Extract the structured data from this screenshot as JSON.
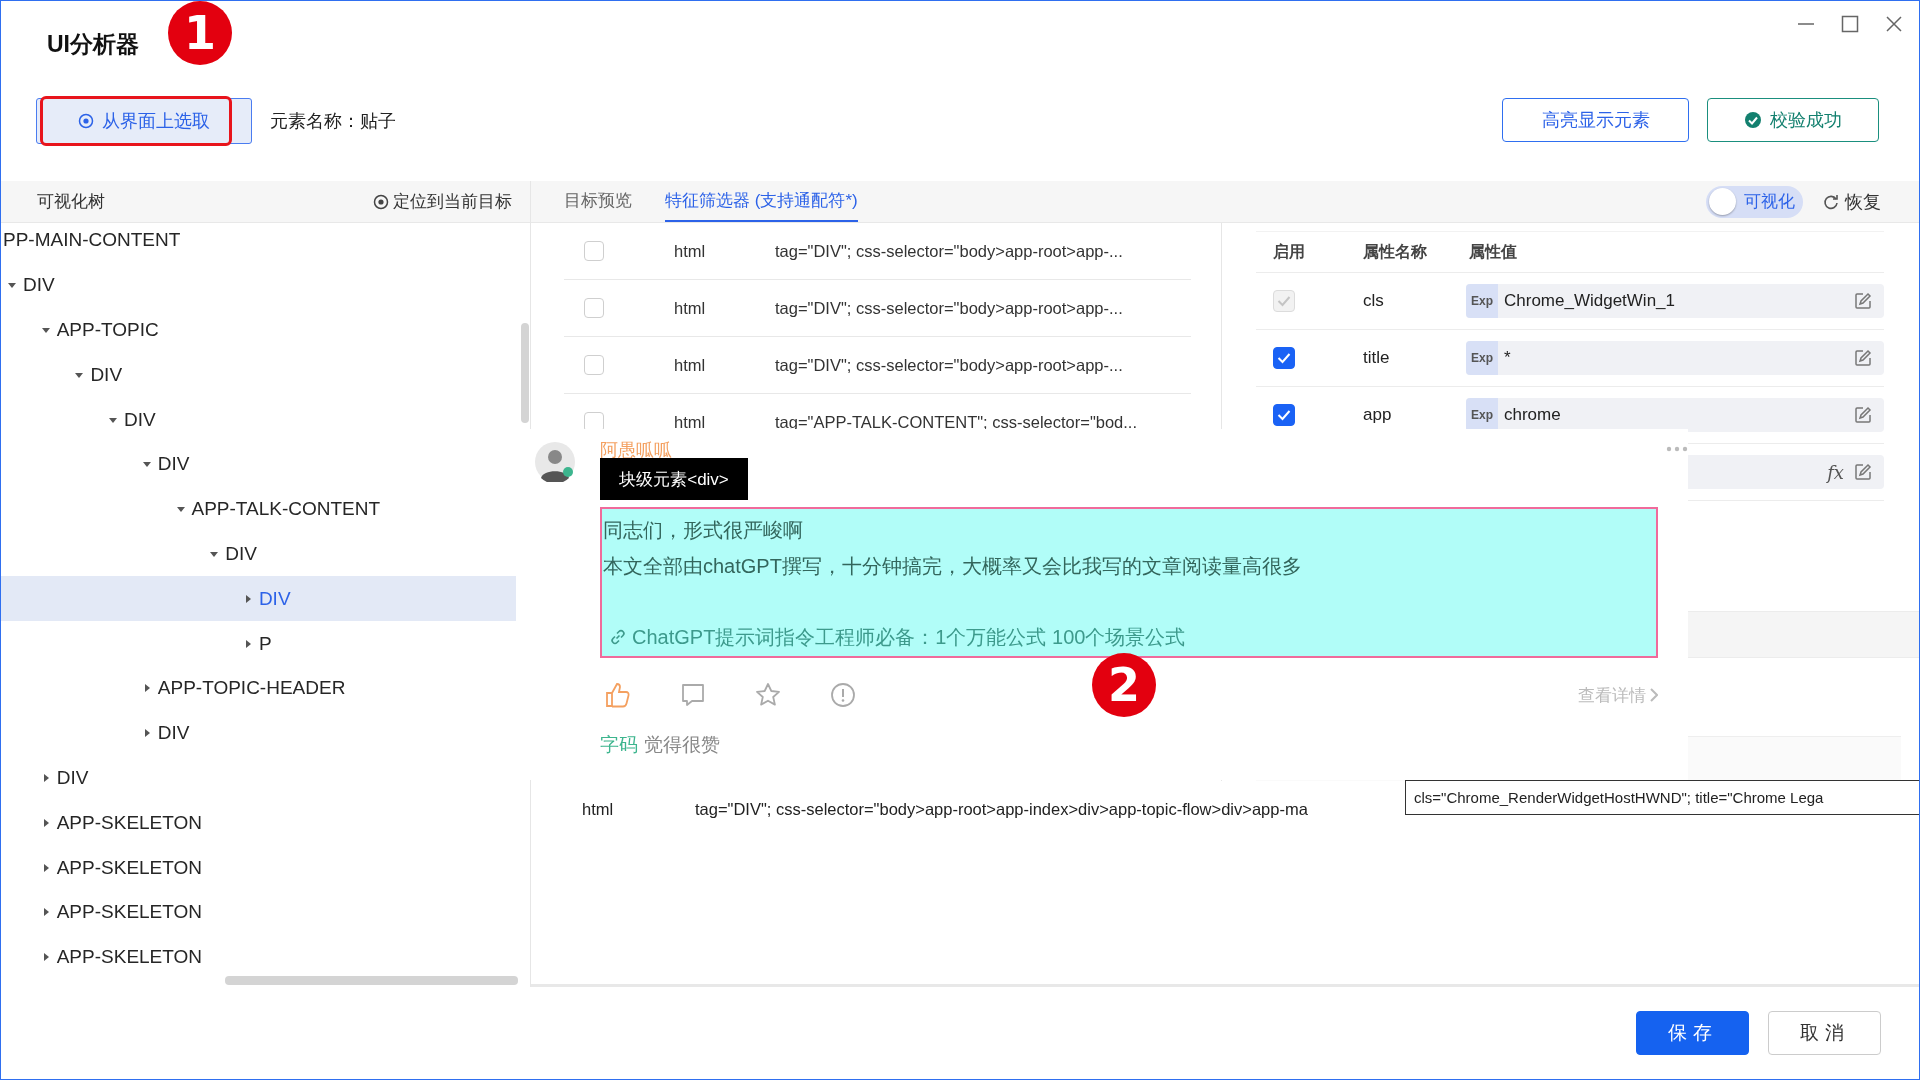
{
  "window": {
    "title": "UI分析器"
  },
  "callouts": [
    {
      "label": "1"
    },
    {
      "label": "2"
    }
  ],
  "toolbar": {
    "pick_button": {
      "label": "从界面上选取",
      "annotated": true
    },
    "element_name": "元素名称：贴子",
    "highlight_button": "高亮显示元素",
    "verify_button": {
      "label": "校验成功",
      "verified": true
    }
  },
  "tree_panel": {
    "title": "可视化树",
    "locate_button": "定位到当前目标",
    "nodes": [
      {
        "label": "PP-MAIN-CONTENT",
        "selected": false,
        "children": [
          {
            "label": "DIV",
            "expanded": true,
            "selected": false,
            "children": [
              {
                "label": "APP-TOPIC",
                "expanded": true,
                "selected": false,
                "children": [
                  {
                    "label": "DIV",
                    "expanded": true,
                    "selected": false,
                    "children": [
                      {
                        "label": "DIV",
                        "expanded": true,
                        "selected": false,
                        "children": [
                          {
                            "label": "DIV",
                            "expanded": true,
                            "selected": false,
                            "children": [
                              {
                                "label": "APP-TALK-CONTENT",
                                "expanded": true,
                                "selected": false,
                                "children": [
                                  {
                                    "label": "DIV",
                                    "expanded": true,
                                    "selected": false,
                                    "children": [
                                      {
                                        "label": "DIV",
                                        "expanded": false,
                                        "selected": true
                                      },
                                      {
                                        "label": "P",
                                        "expanded": false,
                                        "selected": false
                                      }
                                    ]
                                  }
                                ]
                              }
                            ]
                          },
                          {
                            "label": "APP-TOPIC-HEADER",
                            "expanded": false,
                            "selected": false
                          },
                          {
                            "label": "DIV",
                            "expanded": false,
                            "selected": false
                          }
                        ]
                      }
                    ]
                  }
                ]
              },
              {
                "label": "DIV",
                "expanded": false,
                "selected": false
              },
              {
                "label": "APP-SKELETON",
                "expanded": false,
                "selected": false
              },
              {
                "label": "APP-SKELETON",
                "expanded": false,
                "selected": false
              },
              {
                "label": "APP-SKELETON",
                "expanded": false,
                "selected": false
              },
              {
                "label": "APP-SKELETON",
                "expanded": false,
                "selected": false
              }
            ]
          }
        ]
      }
    ]
  },
  "tabs": [
    {
      "label": "目标预览",
      "selected": false
    },
    {
      "label": "特征筛选器 (支持通配符*)",
      "selected": true
    }
  ],
  "visualize_toggle": {
    "label": "可视化",
    "on": false
  },
  "restore_button": "恢复",
  "filter_rows": [
    {
      "checked": false,
      "type": "html",
      "selector": "tag=\"DIV\"; css-selector=\"body>app-root>app-..."
    },
    {
      "checked": false,
      "type": "html",
      "selector": "tag=\"DIV\"; css-selector=\"body>app-root>app-..."
    },
    {
      "checked": false,
      "type": "html",
      "selector": "tag=\"DIV\"; css-selector=\"body>app-root>app-..."
    },
    {
      "checked": false,
      "type": "html",
      "selector": "tag=\"APP-TALK-CONTENT\"; css-selector=\"bod..."
    }
  ],
  "properties": {
    "columns": [
      "启用",
      "属性名称",
      "属性值"
    ],
    "rows": [
      {
        "kind": "exp",
        "enabled": true,
        "disabled": true,
        "name": "cls",
        "badge": "Exp",
        "value": "Chrome_WidgetWin_1"
      },
      {
        "kind": "exp",
        "enabled": true,
        "disabled": false,
        "name": "title",
        "badge": "Exp",
        "value": "*"
      },
      {
        "kind": "exp",
        "enabled": true,
        "disabled": false,
        "name": "app",
        "badge": "Exp",
        "value": "chrome"
      },
      {
        "kind": "fx",
        "icon_text": "fx"
      }
    ]
  },
  "post_popup": {
    "author": "阿愚呱呱",
    "element_tooltip": "块级元素<div>",
    "lines": [
      "同志们，形式很严峻啊",
      "本文全部由chatGPT撰写，十分钟搞完，大概率又会比我写的文章阅读量高很多"
    ],
    "link": "ChatGPT提示词指令工程师必备：1个万能公式 100个场景公式",
    "liked": true,
    "details_link": "查看详情",
    "comment": {
      "user": "字码",
      "text": "觉得很赞"
    }
  },
  "bottom_rows": [
    {
      "type": "html",
      "selector": "tag=\"DIV\"; css-selector=\"body>app-root>app-index>div>app-topic-flow>div>app-ma"
    }
  ],
  "window_tooltip": "cls=\"Chrome_RenderWidgetHostHWND\"; title=\"Chrome Lega",
  "footer": {
    "save_button": "保存",
    "cancel_button": "取消"
  }
}
